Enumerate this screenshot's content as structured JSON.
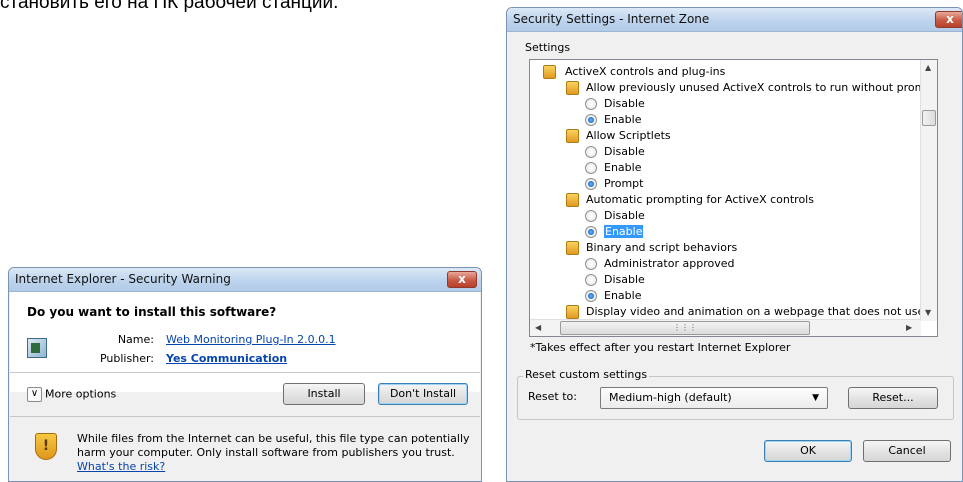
{
  "caption": "становить его на ПК рабочей станции.",
  "security_warning": {
    "title": "Internet Explorer - Security Warning",
    "close_label": "x",
    "question": "Do you want to install this software?",
    "name_label": "Name:",
    "name_value": "Web Monitoring Plug-In 2.0.0.1",
    "publisher_label": "Publisher:",
    "publisher_value": "Yes Communication",
    "more_options_label": "More options",
    "install_label": "Install",
    "dont_install_label": "Don't Install",
    "warning_text": "While files from the Internet can be useful, this file type can potentially harm your computer. Only install software from publishers you trust.",
    "risk_link": "What's the risk?"
  },
  "security_settings": {
    "title": "Security Settings - Internet Zone",
    "close_label": "x",
    "settings_group_label": "Settings",
    "items": {
      "activex": "ActiveX controls and plug-ins",
      "allow_prev": "Allow previously unused ActiveX controls to run without prom",
      "allow_prev_disable": "Disable",
      "allow_prev_enable": "Enable",
      "scriptlets": "Allow Scriptlets",
      "scriptlets_disable": "Disable",
      "scriptlets_enable": "Enable",
      "scriptlets_prompt": "Prompt",
      "auto_prompt": "Automatic prompting for ActiveX controls",
      "auto_prompt_disable": "Disable",
      "auto_prompt_enable": "Enable",
      "binary": "Binary and script behaviors",
      "binary_admin": "Administrator approved",
      "binary_disable": "Disable",
      "binary_enable": "Enable",
      "display_video": "Display video and animation on a webpage that does not use"
    },
    "note": "*Takes effect after you restart Internet Explorer",
    "reset_group_label": "Reset custom settings",
    "reset_to_label": "Reset to:",
    "reset_to_value": "Medium-high (default)",
    "reset_button": "Reset...",
    "ok_label": "OK",
    "cancel_label": "Cancel"
  }
}
